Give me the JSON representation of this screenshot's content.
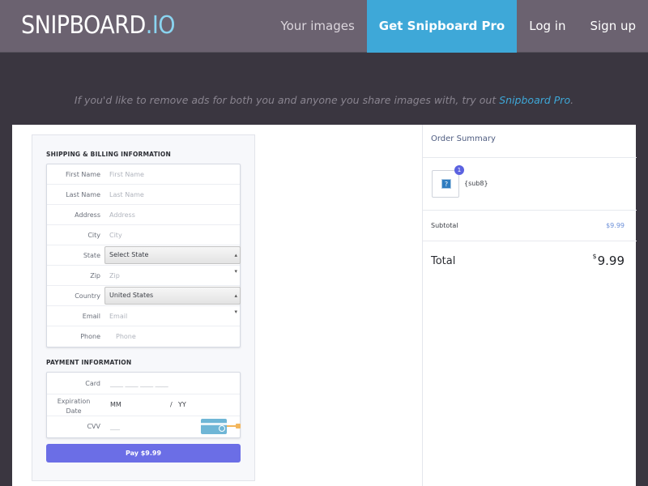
{
  "header": {
    "logo_main": "SNIPBOARD",
    "logo_tld": ".IO",
    "nav": {
      "your_images": "Your images",
      "get_pro": "Get Snipboard Pro",
      "log_in": "Log in",
      "sign_up": "Sign up"
    }
  },
  "notice": {
    "text": "If you'd like to remove ads for both you and anyone you share images with, try out ",
    "link": "Snipboard Pro",
    "suffix": "."
  },
  "checkout": {
    "shipping_title": "SHIPPING & BILLING INFORMATION",
    "shipping_fields": [
      {
        "label": "First Name",
        "placeholder": "First Name"
      },
      {
        "label": "Last Name",
        "placeholder": "Last Name"
      },
      {
        "label": "Address",
        "placeholder": "Address"
      },
      {
        "label": "City",
        "placeholder": "City"
      },
      {
        "label": "State",
        "value": "Select State"
      },
      {
        "label": "Zip",
        "placeholder": "Zip"
      },
      {
        "label": "Country",
        "value": "United States"
      },
      {
        "label": "Email",
        "placeholder": "Email"
      },
      {
        "label": "Phone",
        "placeholder": "Phone"
      }
    ],
    "payment_title": "PAYMENT INFORMATION",
    "card_label": "Card",
    "card_placeholder": "____ ____ ____ ____",
    "expiration_label_1": "Expiration",
    "expiration_label_2": "Date",
    "exp_mm": "MM",
    "exp_slash": "/",
    "exp_yy": "YY",
    "cvv_label": "CVV",
    "cvv_placeholder": "___",
    "pay_button": "Pay $9.99"
  },
  "order_summary": {
    "title": "Order Summary",
    "badge_count": "1",
    "thumb_glyph": "?",
    "item_name": "{sub8}",
    "subtotal_label": "Subtotal",
    "subtotal_value": "$9.99",
    "total_label": "Total",
    "total_currency": "$",
    "total_value": "9.99"
  },
  "colors": {
    "topbar": "#6b6270",
    "pro_button": "#3ea8d8",
    "page_bg": "#3a3640",
    "pay_button": "#6b6ee6"
  }
}
